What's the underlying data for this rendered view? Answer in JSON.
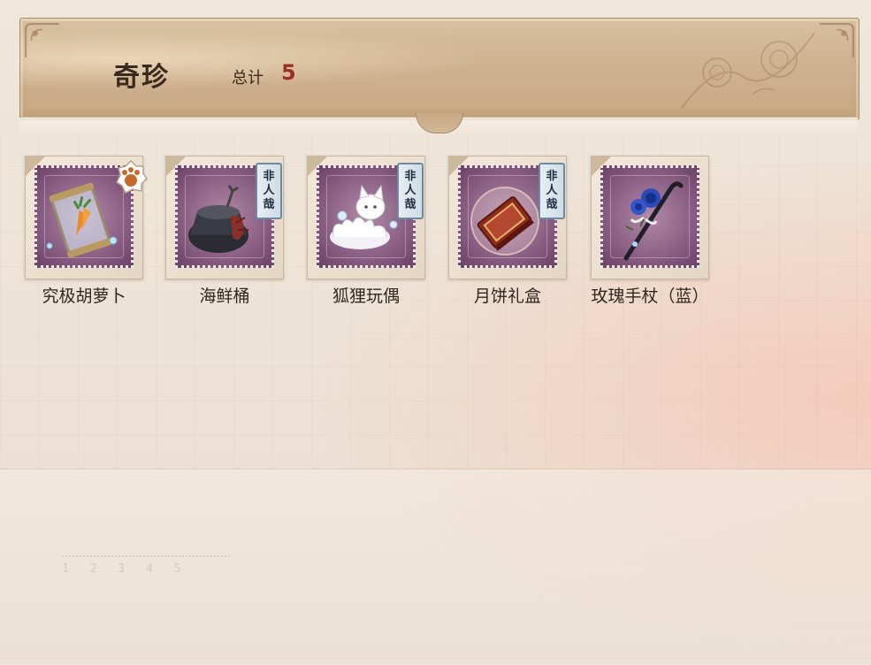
{
  "header": {
    "title": "奇珍",
    "total_label": "总计",
    "total_value": "5"
  },
  "items": [
    {
      "name": "究极胡萝卜",
      "icon": "carrot-jar-icon",
      "badge": "paw-badge-icon",
      "tag": []
    },
    {
      "name": "海鲜桶",
      "icon": "seafood-bucket-icon",
      "tag": [
        "非",
        "人",
        "哉"
      ]
    },
    {
      "name": "狐狸玩偶",
      "icon": "fox-plush-icon",
      "tag": [
        "非",
        "人",
        "哉"
      ]
    },
    {
      "name": "月饼礼盒",
      "icon": "mooncake-box-icon",
      "tag": [
        "非",
        "人",
        "哉"
      ]
    },
    {
      "name": "玫瑰手杖（蓝）",
      "icon": "blue-rose-cane-icon",
      "tag": []
    }
  ],
  "colors": {
    "banner": "#cdb08d",
    "stamp": "#8e6388",
    "total_value": "#9a2f24",
    "tag_border": "#6b8aa3"
  }
}
